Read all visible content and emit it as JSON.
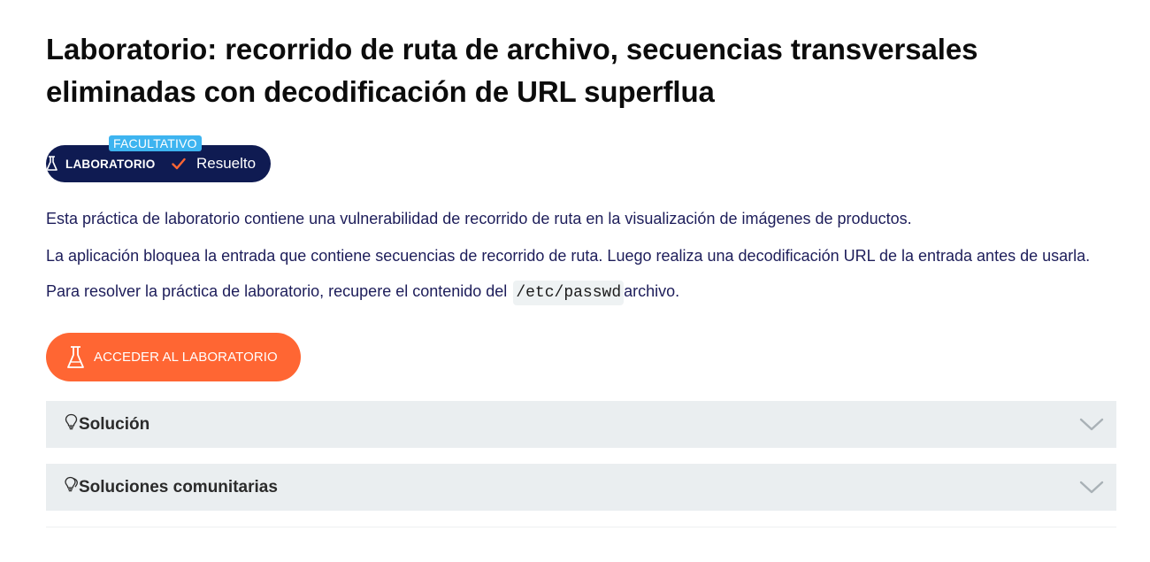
{
  "lab": {
    "title": "Laboratorio: recorrido de ruta de archivo, secuencias transversales eliminadas con decodificación de URL superflua",
    "badge": {
      "tag": "FACULTATIVO",
      "label": "LABORATORIO",
      "status": "Resuelto",
      "icons": [
        "flask-icon",
        "check-icon"
      ]
    },
    "description": {
      "p1": "Esta práctica de laboratorio contiene una vulnerabilidad de recorrido de ruta en la visualización de imágenes de productos.",
      "p2": "La aplicación bloquea la entrada que contiene secuencias de recorrido de ruta. Luego realiza una decodificación URL de la entrada antes de usarla.",
      "p3_before": "Para resolver la práctica de laboratorio, recupere el contenido del",
      "p3_code": "/etc/passwd",
      "p3_after": "archivo."
    },
    "access_button": "ACCEDER AL LABORATORIO",
    "accordions": [
      {
        "label": "Solución",
        "icon": "lightbulb-icon"
      },
      {
        "label": "Soluciones comunitarias",
        "icon": "lightbulbs-icon"
      }
    ]
  },
  "colors": {
    "badge_bg": "#0f1b52",
    "badge_tag": "#3db4f0",
    "check": "#ff6633",
    "button": "#ff6633",
    "text": "#1d1d5a",
    "accordion_bg": "#eaeef0"
  }
}
